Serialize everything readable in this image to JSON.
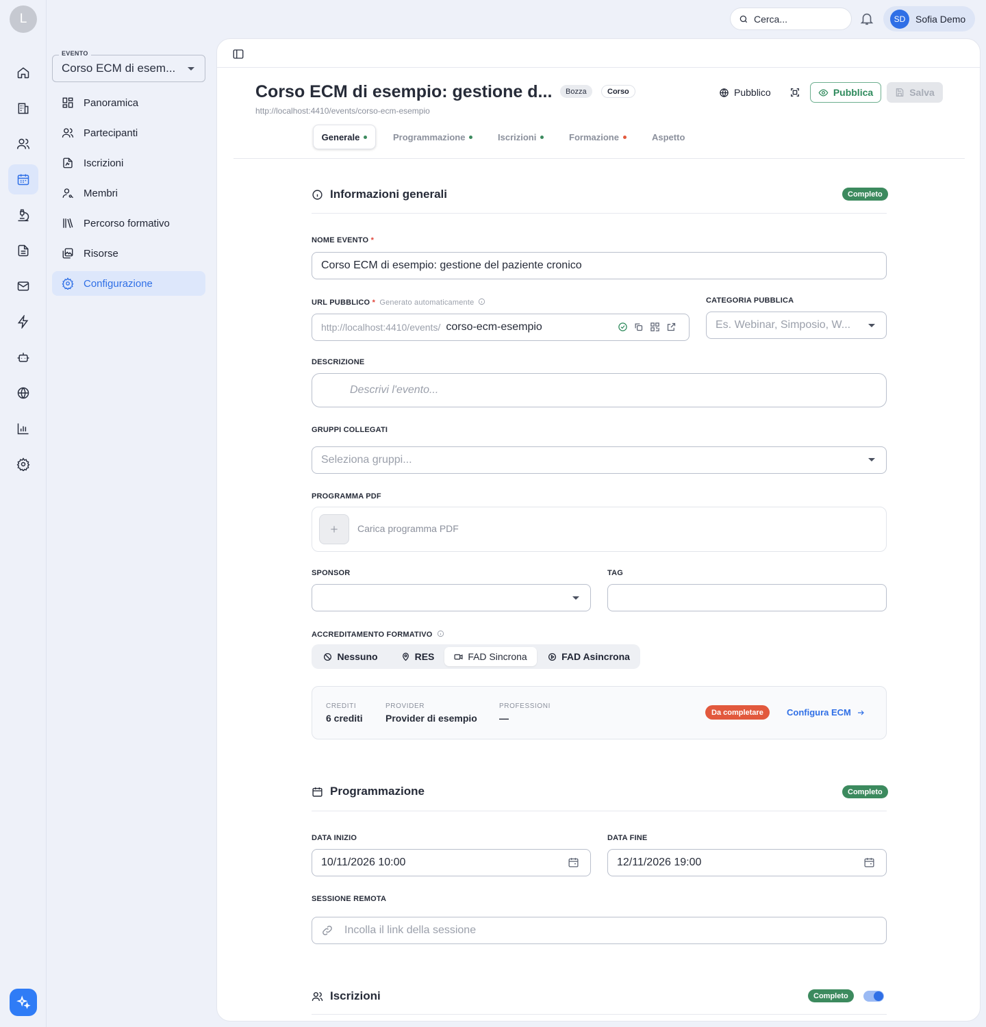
{
  "rail": {
    "avatar_letter": "L",
    "items": [
      "home-icon",
      "building-icon",
      "users-icon",
      "calendar-icon",
      "microscope-icon",
      "document-icon",
      "mail-icon",
      "bolt-icon",
      "bot-icon",
      "globe-icon",
      "chart-icon",
      "gear-icon"
    ],
    "active_item": "calendar-icon",
    "assistant_icon": "sparkles-icon"
  },
  "topbar": {
    "search_placeholder": "Cerca...",
    "user_initials": "SD",
    "user_name": "Sofia Demo"
  },
  "sidebar": {
    "event_legend": "EVENTO",
    "event_value": "Corso ECM di esem...",
    "items": [
      {
        "label": "Panoramica",
        "icon": "dashboard-icon"
      },
      {
        "label": "Partecipanti",
        "icon": "users-icon"
      },
      {
        "label": "Iscrizioni",
        "icon": "file-signature-icon"
      },
      {
        "label": "Membri",
        "icon": "member-icon"
      },
      {
        "label": "Percorso formativo",
        "icon": "library-icon"
      },
      {
        "label": "Risorse",
        "icon": "images-icon"
      },
      {
        "label": "Configurazione",
        "icon": "gear-icon"
      }
    ],
    "active": "Configurazione"
  },
  "header": {
    "title": "Corso ECM di esempio: gestione d...",
    "chip_status": "Bozza",
    "chip_type": "Corso",
    "url": "http://localhost:4410/events/corso-ecm-esempio",
    "visibility": "Pubblico",
    "publish_label": "Pubblica",
    "save_label": "Salva"
  },
  "tabs": [
    {
      "label": "Generale",
      "dot": "#3c8a5e"
    },
    {
      "label": "Programmazione",
      "dot": "#3c8a5e"
    },
    {
      "label": "Iscrizioni",
      "dot": "#3c8a5e"
    },
    {
      "label": "Formazione",
      "dot": "#e2593d"
    },
    {
      "label": "Aspetto",
      "dot": ""
    }
  ],
  "general": {
    "title": "Informazioni generali",
    "status": "Completo",
    "name_label": "NOME EVENTO",
    "name_value": "Corso ECM di esempio: gestione del paziente cronico",
    "url_label": "URL PUBBLICO",
    "url_hint": "Generato automaticamente",
    "url_prefix": "http://localhost:4410/events/",
    "url_slug": "corso-ecm-esempio",
    "category_label": "CATEGORIA PUBBLICA",
    "category_placeholder": "Es. Webinar, Simposio, W...",
    "description_label": "DESCRIZIONE",
    "description_placeholder": "Descrivi l'evento...",
    "groups_label": "GRUPPI COLLEGATI",
    "groups_placeholder": "Seleziona gruppi...",
    "pdf_label": "PROGRAMMA PDF",
    "pdf_upload": "Carica programma PDF",
    "sponsor_label": "SPONSOR",
    "tag_label": "TAG",
    "accreditation_label": "ACCREDITAMENTO FORMATIVO",
    "accreditation_options": [
      "Nessuno",
      "RES",
      "FAD Sincrona",
      "FAD Asincrona"
    ],
    "accreditation_selected": "FAD Sincrona",
    "ecm": {
      "credits_key": "CREDITI",
      "credits_value": "6 crediti",
      "provider_key": "PROVIDER",
      "provider_value": "Provider di esempio",
      "professions_key": "PROFESSIONI",
      "professions_value": "—",
      "status": "Da completare",
      "configure_label": "Configura ECM"
    }
  },
  "schedule": {
    "title": "Programmazione",
    "status": "Completo",
    "start_label": "DATA INIZIO",
    "start_value": "10/11/2026 10:00",
    "end_label": "DATA FINE",
    "end_value": "12/11/2026 19:00",
    "remote_label": "SESSIONE REMOTA",
    "remote_placeholder": "Incolla il link della sessione"
  },
  "registrations": {
    "title": "Iscrizioni",
    "status": "Completo",
    "enabled": true
  },
  "colors": {
    "accent": "#2f6fe6",
    "success": "#3c8a5e",
    "warning": "#e2593d"
  }
}
